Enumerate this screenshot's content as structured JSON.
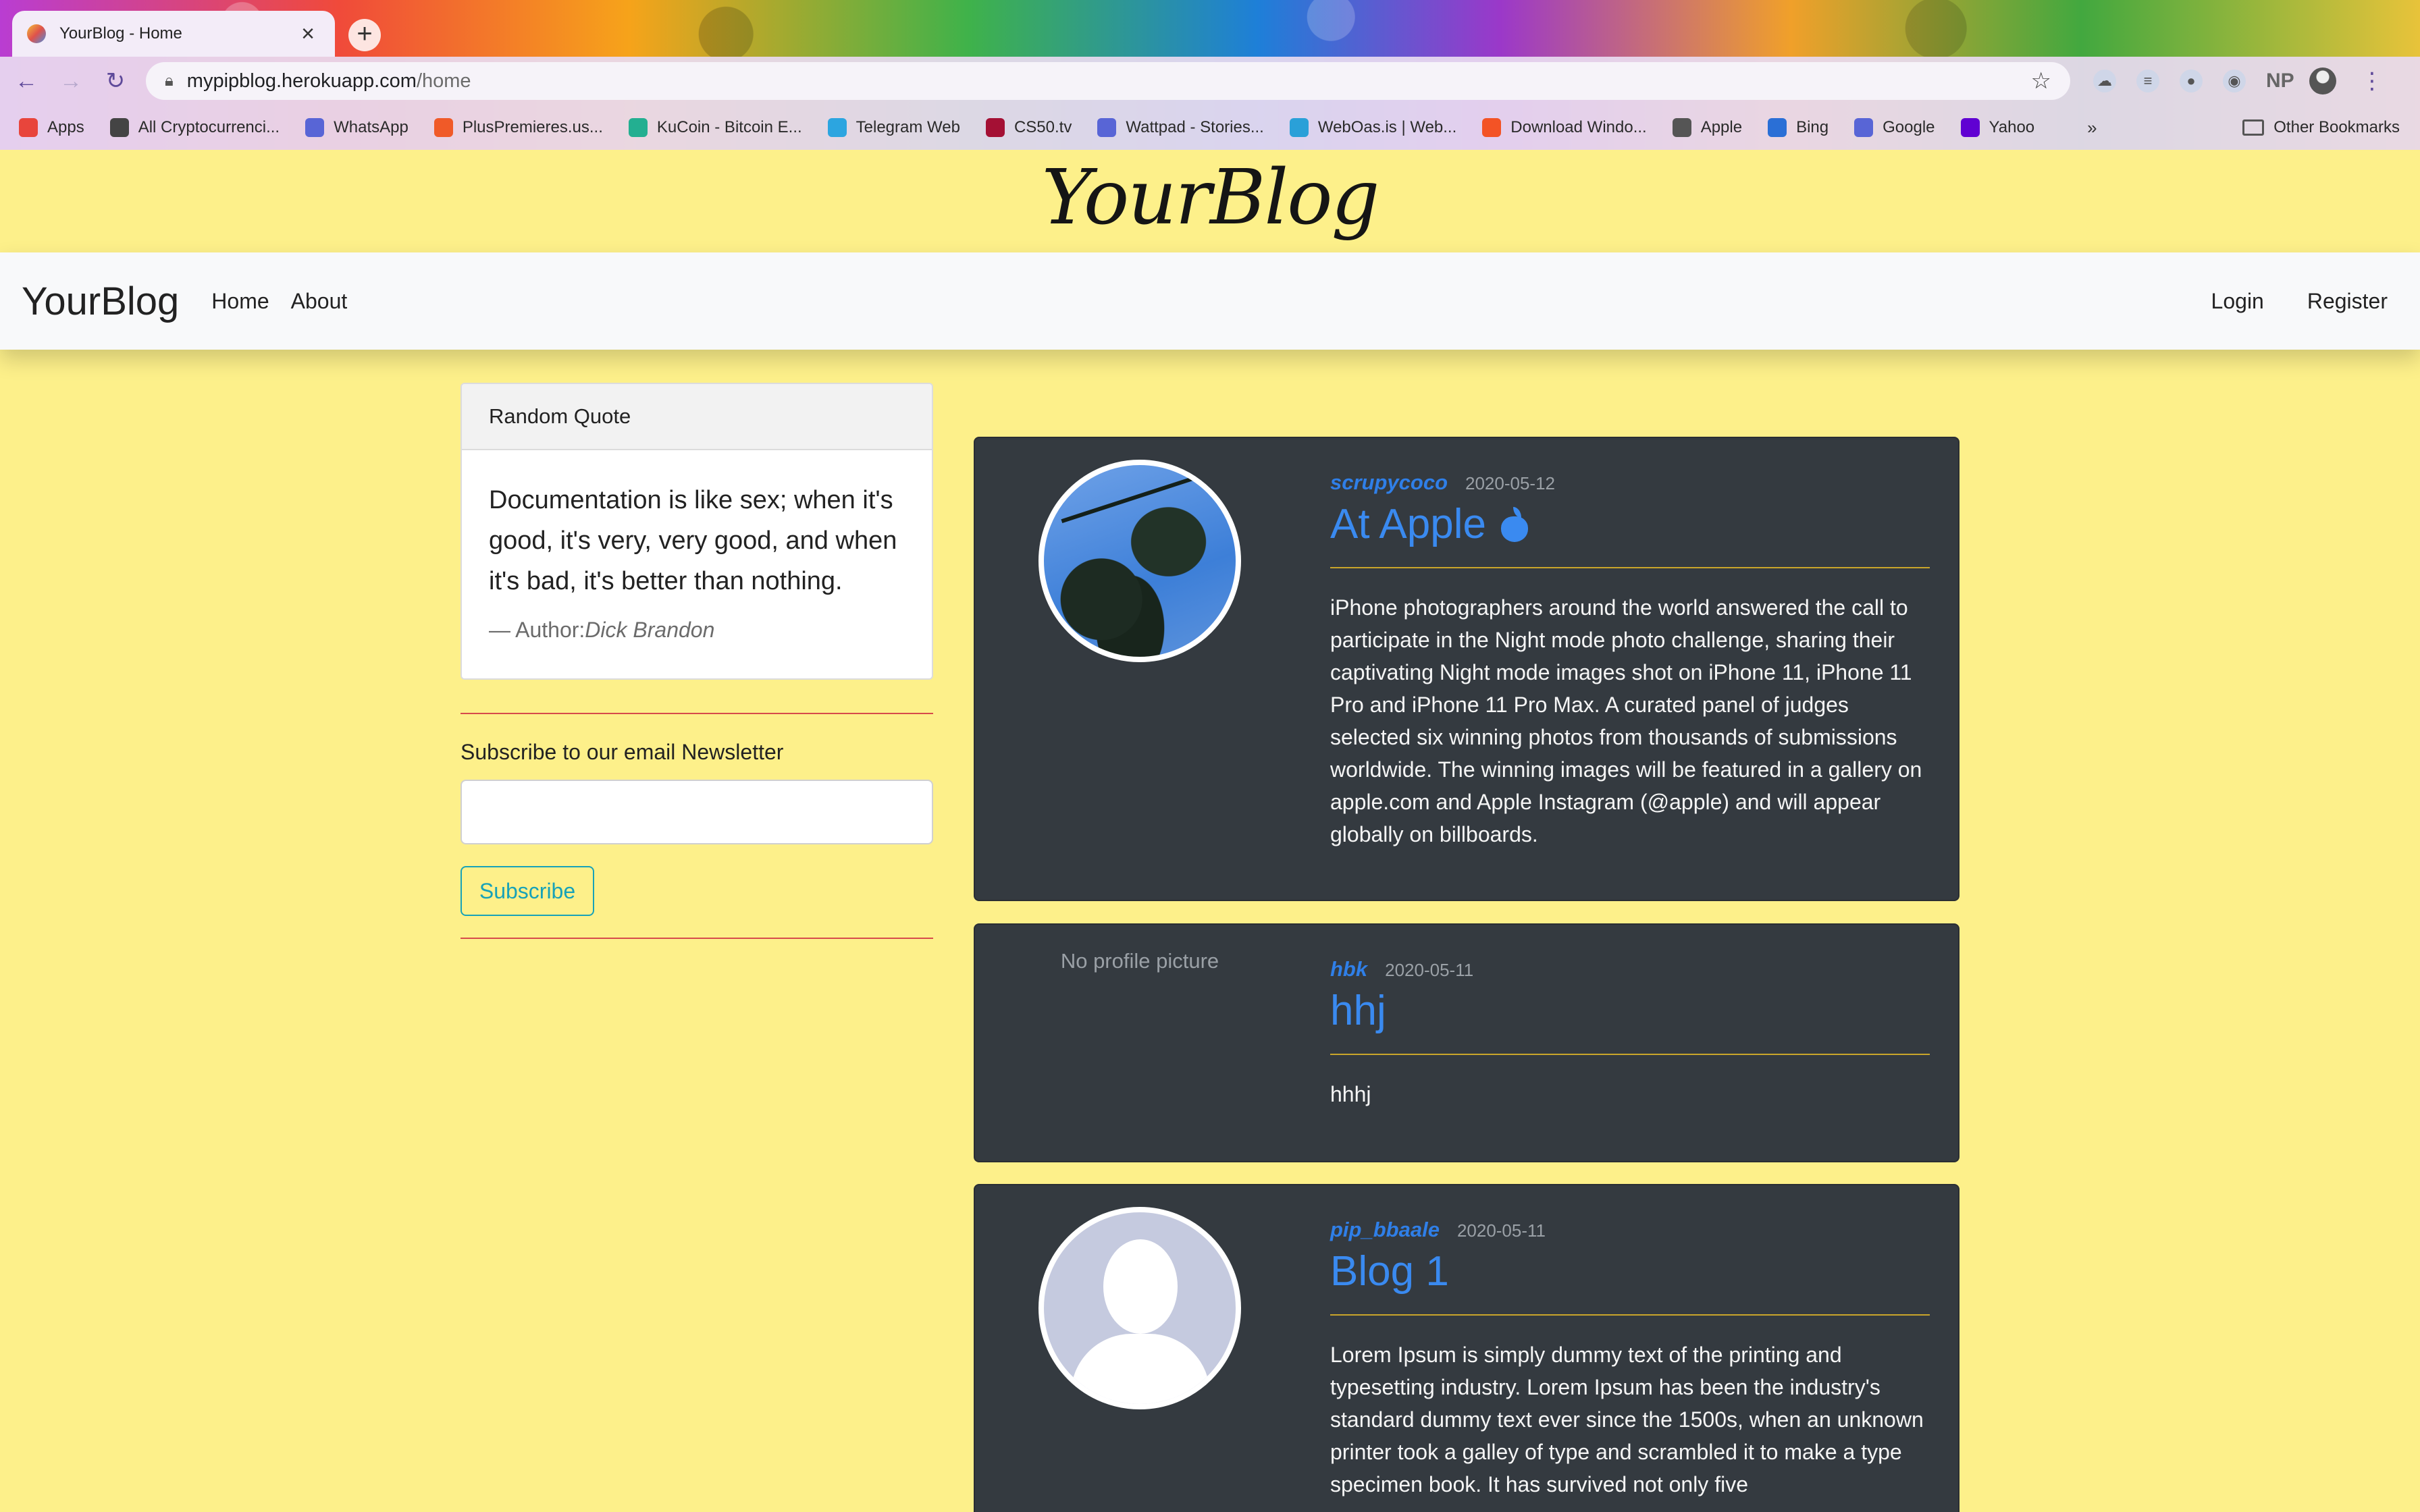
{
  "browser": {
    "tab_title": "YourBlog - Home",
    "url_host": "mypipblog.herokuapp.com",
    "url_path": "/home",
    "bookmarks": [
      {
        "label": "Apps",
        "color": "#e8453c"
      },
      {
        "label": "All Cryptocurrenci...",
        "color": "#444444"
      },
      {
        "label": "WhatsApp",
        "color": "#5865d6"
      },
      {
        "label": "PlusPremieres.us...",
        "color": "#f05a28"
      },
      {
        "label": "KuCoin - Bitcoin E...",
        "color": "#23af91"
      },
      {
        "label": "Telegram Web",
        "color": "#2ca5e0"
      },
      {
        "label": "CS50.tv",
        "color": "#a41034"
      },
      {
        "label": "Wattpad - Stories...",
        "color": "#5865d6"
      },
      {
        "label": "WebOas.is | Web...",
        "color": "#2aa0d8"
      },
      {
        "label": "Download Windo...",
        "color": "#f35325"
      },
      {
        "label": "Apple",
        "color": "#555555"
      },
      {
        "label": "Bing",
        "color": "#2a6fd6"
      },
      {
        "label": "Google",
        "color": "#5865d6"
      },
      {
        "label": "Yahoo",
        "color": "#6001d2"
      }
    ],
    "bookmarks_more": "»",
    "other_bookmarks": "Other Bookmarks",
    "ext_np": "NP"
  },
  "site": {
    "script_logo": "YourBlog",
    "brand": "YourBlog",
    "nav": {
      "home": "Home",
      "about": "About",
      "login": "Login",
      "register": "Register"
    }
  },
  "sidebar": {
    "quote_header": "Random Quote",
    "quote_text": "Documentation is like sex; when it's good, it's very, very good, and when it's bad, it's better than nothing.",
    "quote_author_prefix": "— Author:",
    "quote_author": "Dick Brandon",
    "newsletter_label": "Subscribe to our email Newsletter",
    "newsletter_value": "",
    "subscribe_label": "Subscribe"
  },
  "posts": [
    {
      "author": "scrupycoco",
      "date": "2020-05-12",
      "title": "At Apple",
      "body": "iPhone photographers around the world answered the call to participate in the Night mode photo challenge, sharing their captivating Night mode images shot on iPhone 11, iPhone 11 Pro and iPhone 11 Pro Max. A curated panel of judges selected six winning photos from thousands of submissions worldwide. The winning images will be featured in a gallery on apple.com and Apple Instagram (@apple) and will appear globally on billboards."
    },
    {
      "author": "hbk",
      "date": "2020-05-11",
      "title": "hhj",
      "no_picture": "No profile picture",
      "body": "hhhj"
    },
    {
      "author": "pip_bbaale",
      "date": "2020-05-11",
      "title": "Blog 1",
      "body": "Lorem Ipsum is simply dummy text of the printing and typesetting industry. Lorem Ipsum has been the industry's standard dummy text ever since the 1500s, when an unknown printer took a galley of type and scrambled it to make a type specimen book. It has survived not only five"
    }
  ],
  "colors": {
    "page_bg": "#fdf08a",
    "post_bg": "#343a40",
    "accent_blue": "#3a8af0",
    "divider_gold": "#c9a52a",
    "subscribe_teal": "#17a2b8",
    "rule_red": "#d64b4b"
  }
}
